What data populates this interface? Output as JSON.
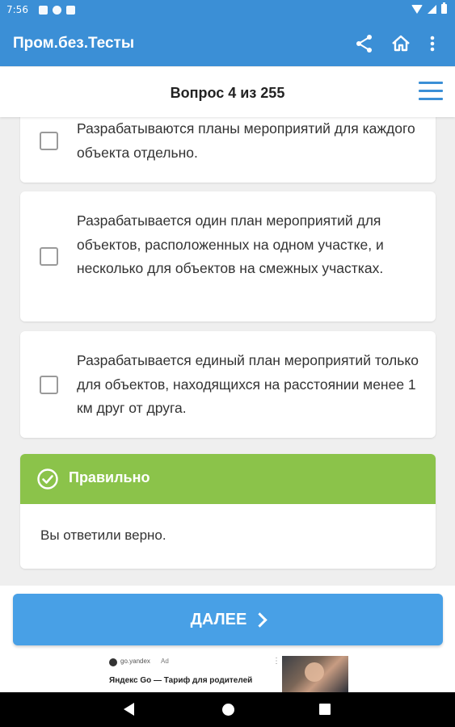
{
  "status_bar": {
    "time": "7:56"
  },
  "app_bar": {
    "title": "Пром.без.Тесты",
    "icons": [
      "share-icon",
      "home-icon",
      "more-vert-icon"
    ]
  },
  "question": {
    "header": "Вопрос 4 из 255",
    "menu_icon": "hamburger-menu-icon"
  },
  "options": [
    {
      "text": "Разрабатываются планы мероприятий для каждого объекта отдельно.",
      "checked": false
    },
    {
      "text": "Разрабатывается один план мероприятий для объектов, расположенных на одном участке, и несколько для объектов на смежных участках.",
      "checked": false
    },
    {
      "text": "Разрабатывается единый план мероприятий только для объектов, находящихся на расстоянии менее 1 км друг от друга.",
      "checked": false
    }
  ],
  "result": {
    "title": "Правильно",
    "message": "Вы ответили верно.",
    "color": "#8bc34a",
    "icon": "check-circle-icon"
  },
  "next_button": {
    "label": "ДАЛЕЕ",
    "color": "#48a0e6"
  },
  "ad": {
    "domain": "go.yandex",
    "label": "Ad",
    "title": "Яндекс Go — Тариф для родителей"
  },
  "colors": {
    "primary": "#3b8fd6",
    "background": "#efefef"
  }
}
